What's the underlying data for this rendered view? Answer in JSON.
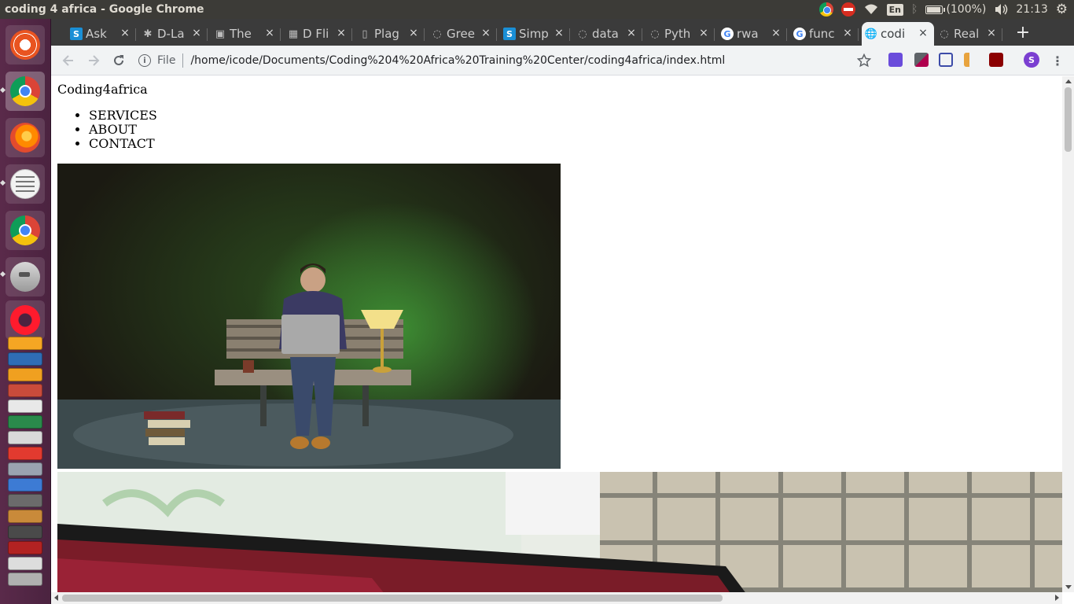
{
  "system_panel": {
    "window_title": "coding 4 africa - Google Chrome",
    "keyboard_layout": "En",
    "battery_text": "(100%)",
    "battery_level": 1.0,
    "clock": "21:13"
  },
  "launcher": {
    "apps": [
      {
        "name": "ubuntu-dash-icon"
      },
      {
        "name": "chrome-icon"
      },
      {
        "name": "firefox-icon"
      },
      {
        "name": "text-editor-icon"
      },
      {
        "name": "chrome-icon"
      },
      {
        "name": "file-manager-icon"
      },
      {
        "name": "opera-icon"
      }
    ]
  },
  "browser": {
    "tabs": [
      {
        "label": "Ask",
        "favicon": "S",
        "favicon_color": "#1a8fd6"
      },
      {
        "label": "D-La",
        "favicon": "✱",
        "favicon_color": "#f36b21"
      },
      {
        "label": "The",
        "favicon": "▣",
        "favicon_color": "#e37400"
      },
      {
        "label": "D Fli",
        "favicon": "▦",
        "favicon_color": "#333333"
      },
      {
        "label": "Plag",
        "favicon": "▯",
        "favicon_color": "#3a6ea5"
      },
      {
        "label": "Gree",
        "favicon": "◌",
        "favicon_color": "#555555"
      },
      {
        "label": "Simp",
        "favicon": "S",
        "favicon_color": "#1a8fd6"
      },
      {
        "label": "data",
        "favicon": "◌",
        "favicon_color": "#555555"
      },
      {
        "label": "Pyth",
        "favicon": "◌",
        "favicon_color": "#555555"
      },
      {
        "label": "rwa",
        "favicon": "G",
        "favicon_color": "#ffffff"
      },
      {
        "label": "func",
        "favicon": "G",
        "favicon_color": "#ffffff"
      },
      {
        "label": "codi",
        "favicon": "🌐",
        "favicon_color": "#f1f3f4",
        "active": true
      },
      {
        "label": "Real",
        "favicon": "◌",
        "favicon_color": "#555555"
      }
    ],
    "close_glyph": "×",
    "new_tab_glyph": "+",
    "omnibox": {
      "scheme_label": "File",
      "url": "/home/icode/Documents/Coding%204%20Africa%20Training%20Center/coding4africa/index.html"
    },
    "profile_initial": "S"
  },
  "page": {
    "site_title": "Coding4africa",
    "nav_items": [
      "SERVICES",
      "ABOUT",
      "CONTACT"
    ]
  }
}
